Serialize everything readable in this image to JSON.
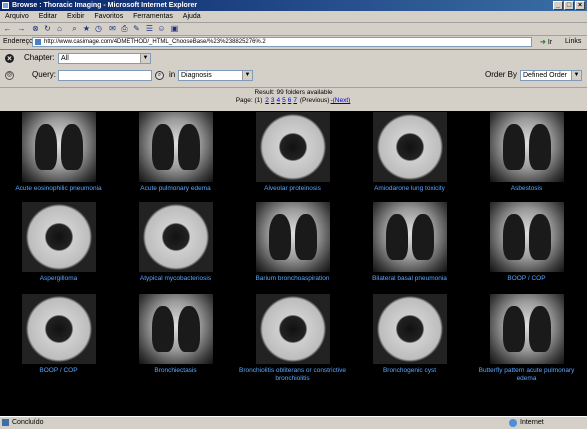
{
  "window": {
    "title": "Browse : Thoracic Imaging - Microsoft Internet Explorer"
  },
  "menu": [
    "Arquivo",
    "Editar",
    "Exibir",
    "Favoritos",
    "Ferramentas",
    "Ajuda"
  ],
  "address": {
    "label": "Endereço",
    "url": "http://www.casimage.com/4DMETHOD/_HTML_ChooseBase/%23%238825276%.2",
    "go_label": "Ir",
    "links_label": "Links"
  },
  "form": {
    "chapter_label": "Chapter:",
    "chapter_value": "All",
    "query_label": "Query:",
    "query_value": "",
    "in_label": "in",
    "in_value": "Diagnosis",
    "orderby_label": "Order By",
    "orderby_value": "Defined Order"
  },
  "result": {
    "text": "Result: 99 folders available",
    "page_prefix": "Page: (1)",
    "pages": [
      "2",
      "3",
      "4",
      "5",
      "6",
      "7"
    ],
    "previous": "(Previous)",
    "next": "-(Next)"
  },
  "items": [
    {
      "caption": "Acute eosinophilic pneumonia",
      "kind": "lung"
    },
    {
      "caption": "Acute pulmonary edema",
      "kind": "lung"
    },
    {
      "caption": "Alveolar proteinosis",
      "kind": "ct"
    },
    {
      "caption": "Amiodarone lung toxicity",
      "kind": "ct"
    },
    {
      "caption": "Asbestosis",
      "kind": "lung"
    },
    {
      "caption": "Aspergilloma",
      "kind": "ct"
    },
    {
      "caption": "Atypical mycobacteriosis",
      "kind": "ct"
    },
    {
      "caption": "Barium bronchoaspiration",
      "kind": "lung"
    },
    {
      "caption": "Bilateral basal pneumonia",
      "kind": "lung"
    },
    {
      "caption": "BOOP / COP",
      "kind": "lung"
    },
    {
      "caption": "BOOP / COP",
      "kind": "ct"
    },
    {
      "caption": "Bronchiectasis",
      "kind": "lung"
    },
    {
      "caption": "Bronchiolitis obliterans or constrictive bronchiolitis",
      "kind": "ct"
    },
    {
      "caption": "Bronchogenic cyst",
      "kind": "ct"
    },
    {
      "caption": "Butterfly pattern acute pulmonary edema",
      "kind": "lung"
    }
  ],
  "status": {
    "left": "Concluído",
    "right": "Internet"
  }
}
